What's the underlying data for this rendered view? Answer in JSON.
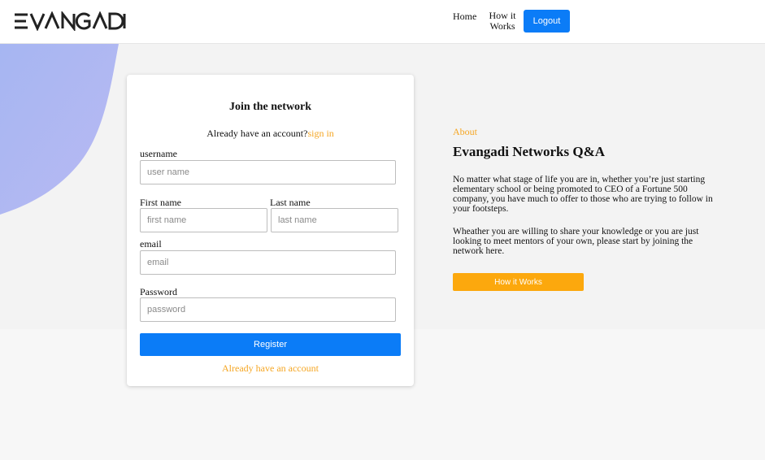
{
  "header": {
    "logo_text": "EVANGADI",
    "nav_home": "Home",
    "nav_how_it_works": "How it Works",
    "logout_label": "Logout"
  },
  "signup_card": {
    "title": "Join the network",
    "have_account_text": "Already have an account?",
    "signin_link": "sign in",
    "username_label": "username",
    "username_placeholder": "user name",
    "first_name_label": "First name",
    "first_name_placeholder": "first name",
    "last_name_label": "Last name",
    "last_name_placeholder": "last name",
    "email_label": "email",
    "email_placeholder": "email",
    "password_label": "Password",
    "password_placeholder": "password",
    "register_label": "Register",
    "already_have_account_link": "Already have an account"
  },
  "about": {
    "tag": "About",
    "title": "Evangadi Networks Q&A",
    "paragraph1": "No matter what stage of life you are in, whether you’re just starting elementary school or being promoted to CEO of a Fortune 500 company, you have much to offer to those who are trying to follow in your footsteps.",
    "paragraph2": "Wheather you are willing to share your knowledge or you are just looking to meet mentors of your own, please start by joining the network here.",
    "how_button_label": "How it Works"
  },
  "colors": {
    "primary_blue": "#0b7cf7",
    "accent_orange": "#f5a623",
    "button_orange": "#fca80d",
    "hero_bg": "#f3f3f3",
    "blob_gradient_start": "#a9b5f2",
    "blob_gradient_end": "#b7c2f5"
  }
}
